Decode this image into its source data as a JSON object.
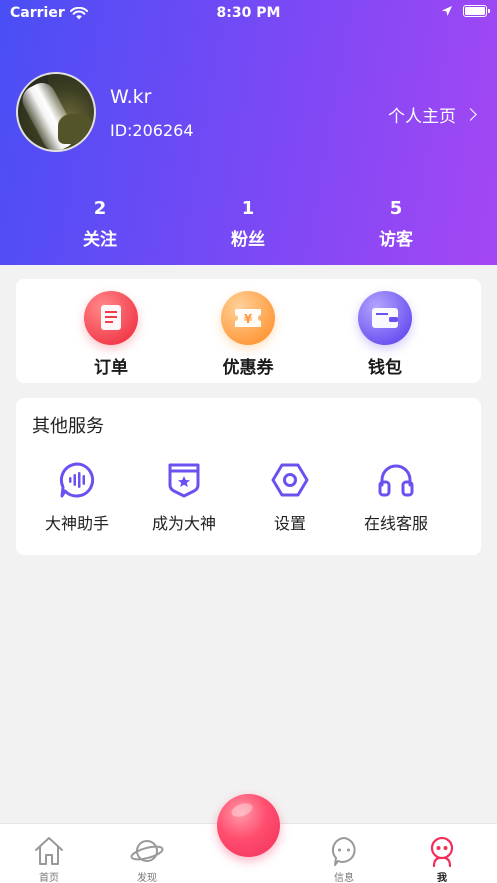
{
  "status_bar": {
    "carrier": "Carrier",
    "time": "8:30 PM"
  },
  "profile": {
    "username": "W.kr",
    "user_id": "ID:206264",
    "homepage_link": "个人主页"
  },
  "stats": [
    {
      "value": "2",
      "label": "关注"
    },
    {
      "value": "1",
      "label": "粉丝"
    },
    {
      "value": "5",
      "label": "访客"
    }
  ],
  "quick_actions": [
    {
      "label": "订单",
      "icon": "order-icon"
    },
    {
      "label": "优惠券",
      "icon": "coupon-icon"
    },
    {
      "label": "钱包",
      "icon": "wallet-icon"
    }
  ],
  "services": {
    "title": "其他服务",
    "items": [
      {
        "label": "大神助手",
        "icon": "voice-assistant-icon"
      },
      {
        "label": "成为大神",
        "icon": "badge-star-icon"
      },
      {
        "label": "设置",
        "icon": "hex-nut-settings-icon"
      },
      {
        "label": "在线客服",
        "icon": "headphones-icon"
      }
    ]
  },
  "tabbar": [
    {
      "label": "首页",
      "icon": "home-icon"
    },
    {
      "label": "发现",
      "icon": "planet-icon"
    },
    {
      "label": "信息",
      "icon": "message-icon"
    },
    {
      "label": "我",
      "icon": "user-icon",
      "active": true
    }
  ],
  "colors": {
    "accent": "#6b52f0",
    "header_start": "#4a4ef5",
    "header_end": "#a447f3",
    "center_button": "#f0305a"
  }
}
